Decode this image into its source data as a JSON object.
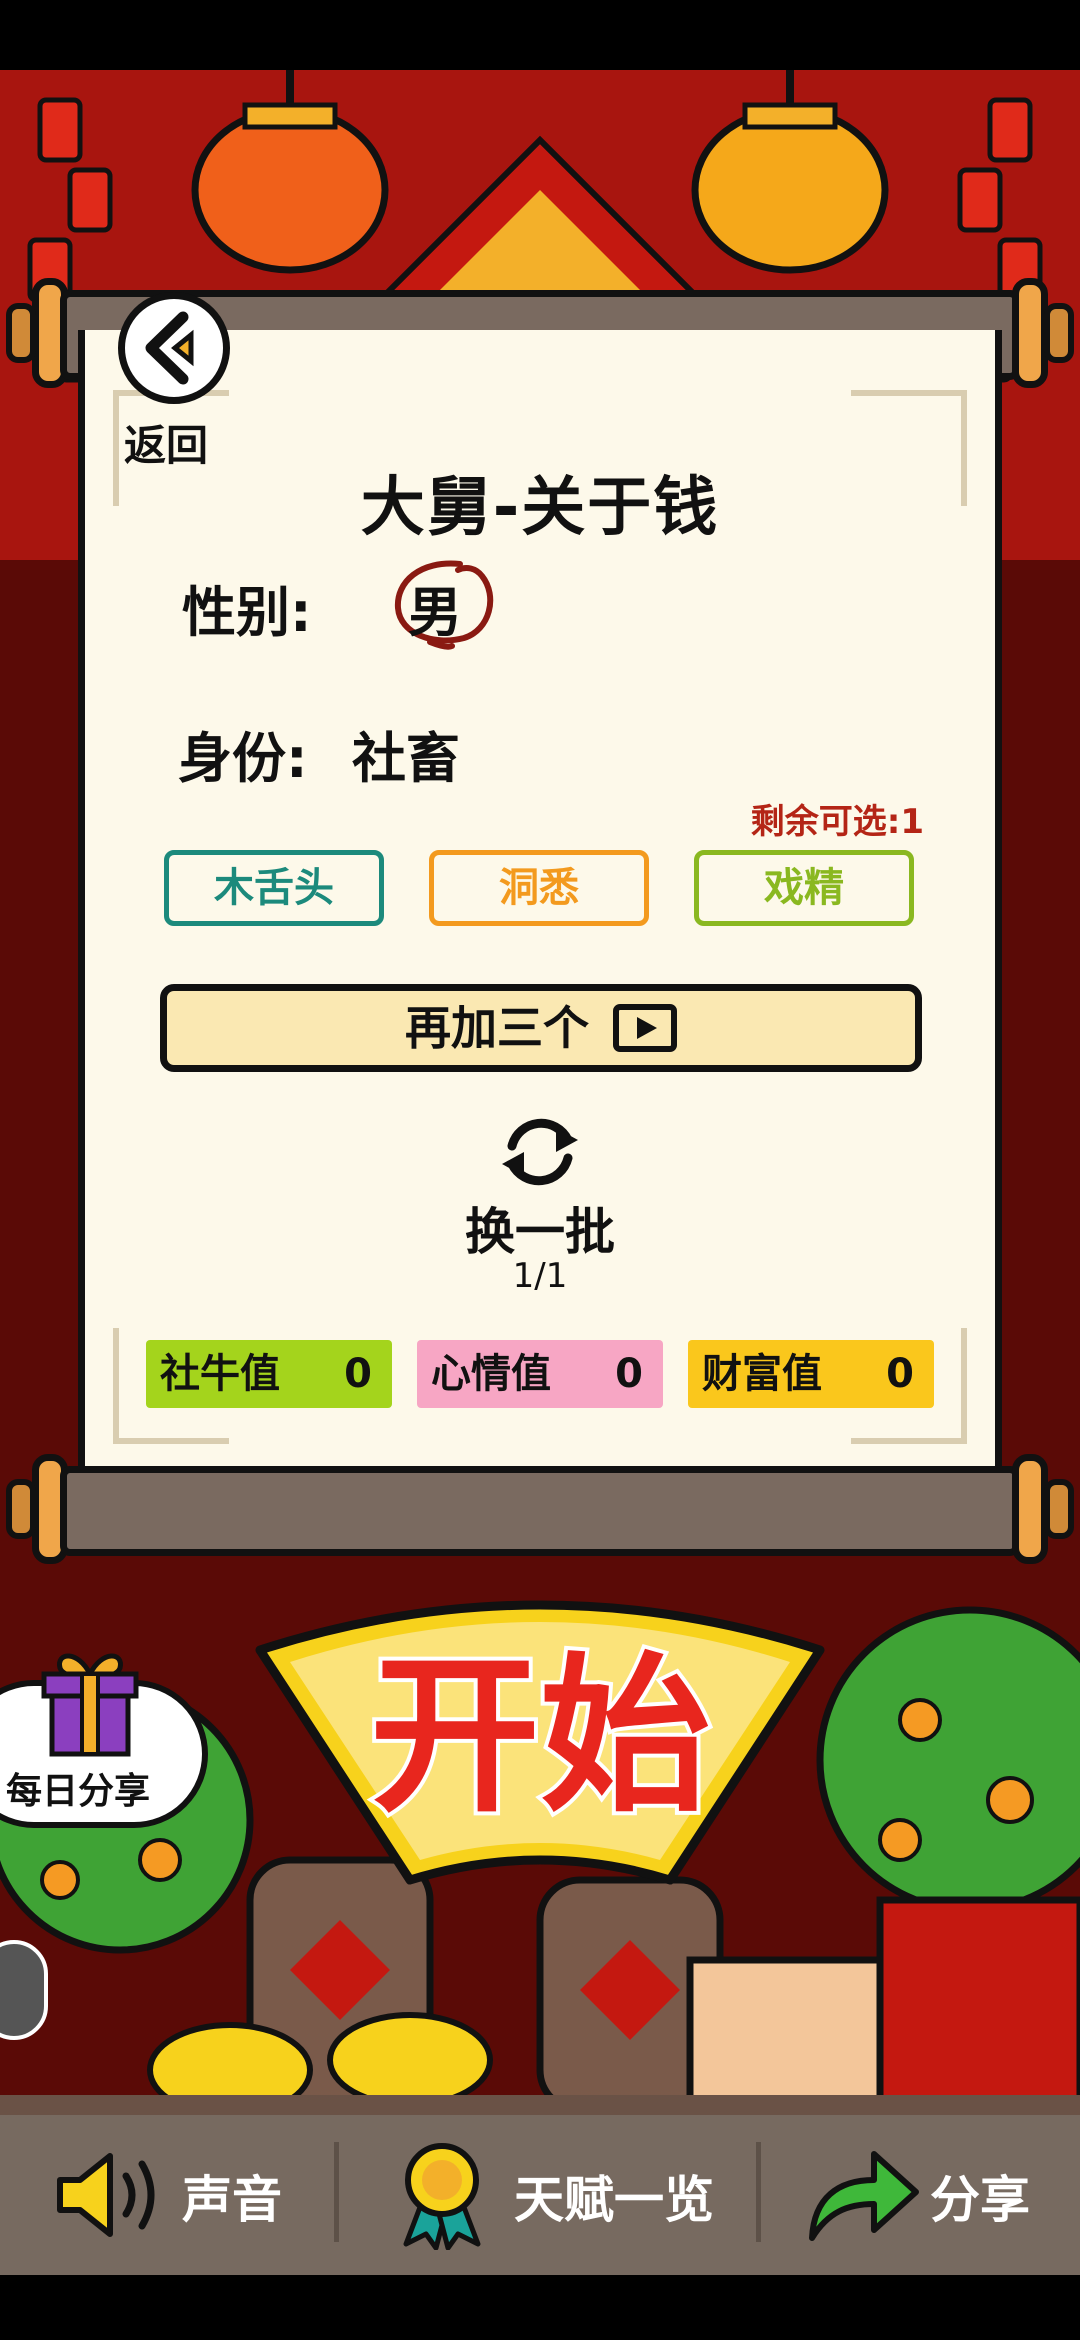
{
  "back": {
    "label": "返回"
  },
  "title": "大舅-关于钱",
  "gender": {
    "label": "性别:",
    "value": "男"
  },
  "identity": {
    "label": "身份:",
    "value": "社畜"
  },
  "remaining": "剩余可选:1",
  "talents": [
    {
      "label": "木舌头",
      "color": "#1c8a7c"
    },
    {
      "label": "洞悉",
      "color": "#f39a1e"
    },
    {
      "label": "戏精",
      "color": "#8ab820"
    }
  ],
  "add_three": {
    "label": "再加三个"
  },
  "refresh": {
    "label": "换一批",
    "page": "1/1"
  },
  "stats": [
    {
      "name": "社牛值",
      "value": "0",
      "color": "#a4d41c"
    },
    {
      "name": "心情值",
      "value": "0",
      "color": "#f7a6c4"
    },
    {
      "name": "财富值",
      "value": "0",
      "color": "#fac71c"
    }
  ],
  "start": {
    "label": "开始"
  },
  "daily_share": {
    "label": "每日分享"
  },
  "bottom": {
    "sound": "声音",
    "talents": "天赋一览",
    "share": "分享"
  },
  "colors": {
    "bg_red": "#a8150f",
    "dark_red": "#5a0a06",
    "paper": "#fdf9ea",
    "bar": "#776a60"
  }
}
